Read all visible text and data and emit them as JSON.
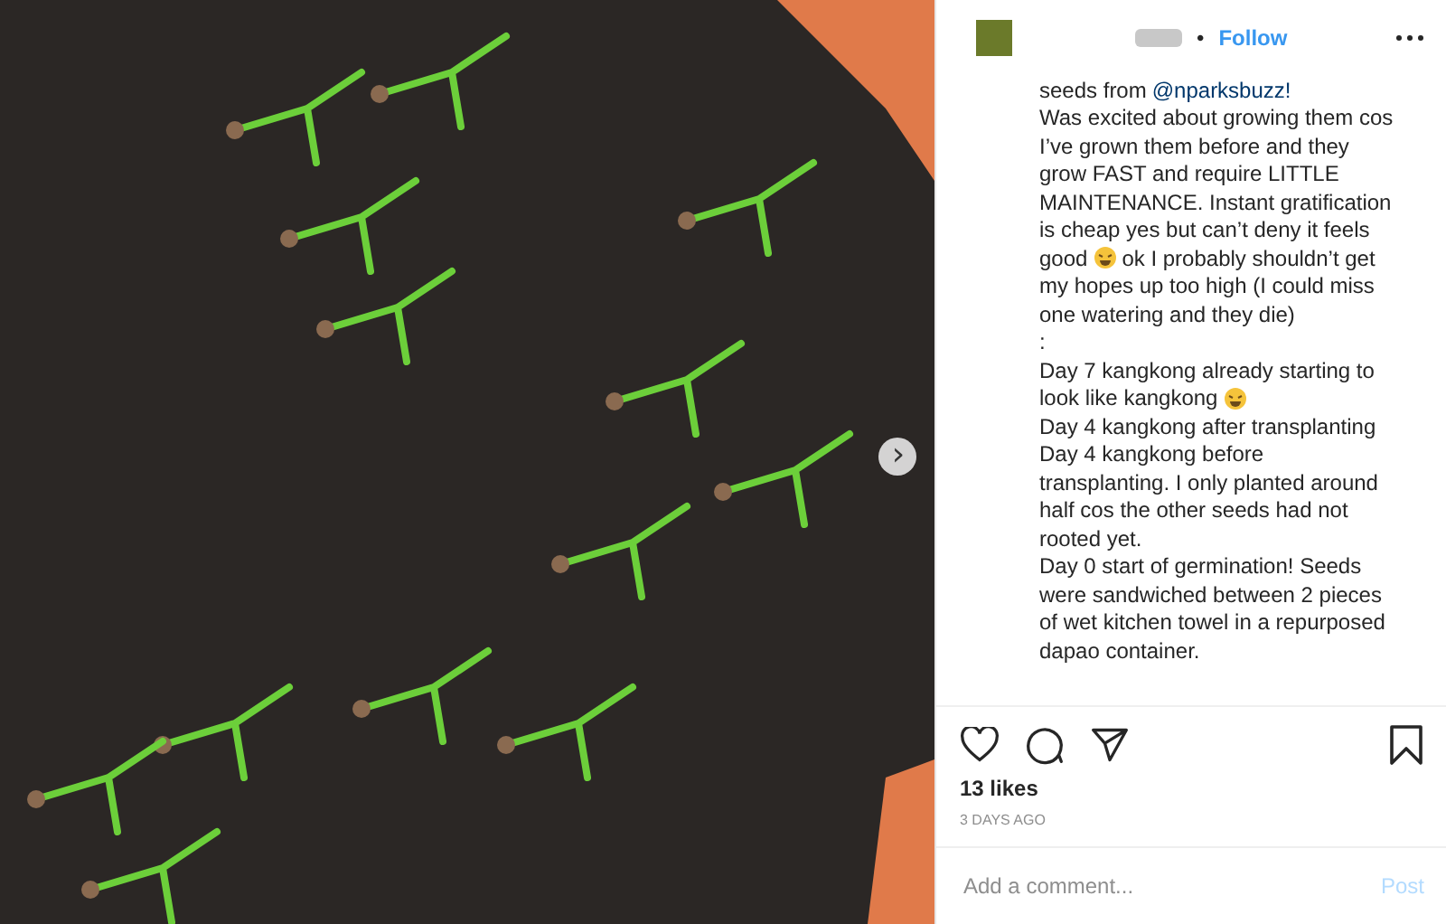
{
  "post": {
    "next_button": "›"
  },
  "header": {
    "separator": "•",
    "follow": "Follow"
  },
  "caption": [
    [
      {
        "kind": "text",
        "text": "seeds from"
      },
      {
        "kind": "link",
        "text": "@nparksbuzz!"
      }
    ],
    [
      {
        "kind": "text",
        "text": "Was excited about growing them cos"
      }
    ],
    [
      {
        "kind": "text",
        "text": "I’ve grown them before and they"
      }
    ],
    [
      {
        "kind": "text",
        "text": "grow FAST and require LITTLE"
      }
    ],
    [
      {
        "kind": "text",
        "text": "MAINTENANCE. Instant gratification"
      }
    ],
    [
      {
        "kind": "text",
        "text": "is cheap yes but can’t deny it feels"
      }
    ],
    [
      {
        "kind": "text",
        "text": "good"
      },
      {
        "kind": "emoji"
      },
      {
        "kind": "text",
        "text": "ok I probably shouldn’t get"
      }
    ],
    [
      {
        "kind": "text",
        "text": "my hopes up too high (I could miss"
      }
    ],
    [
      {
        "kind": "text",
        "text": "one watering and they die)"
      }
    ],
    [
      {
        "kind": "text",
        "text": ":"
      }
    ],
    [
      {
        "kind": "text",
        "text": "Day 7 kangkong already starting to"
      }
    ],
    [
      {
        "kind": "text",
        "text": "look like kangkong"
      },
      {
        "kind": "emoji"
      }
    ],
    [
      {
        "kind": "text",
        "text": "Day 4 kangkong after transplanting"
      }
    ],
    [
      {
        "kind": "text",
        "text": "Day 4 kangkong before"
      }
    ],
    [
      {
        "kind": "text",
        "text": "transplanting. I only planted around"
      }
    ],
    [
      {
        "kind": "text",
        "text": "half cos the other seeds had not"
      }
    ],
    [
      {
        "kind": "text",
        "text": "rooted yet."
      }
    ],
    [
      {
        "kind": "text",
        "text": "Day 0 start of germination! Seeds"
      }
    ],
    [
      {
        "kind": "text",
        "text": "were sandwiched between 2 pieces"
      }
    ],
    [
      {
        "kind": "text",
        "text": "of wet kitchen towel in a repurposed"
      }
    ],
    [
      {
        "kind": "text",
        "text": "dapao container."
      }
    ]
  ],
  "likes": "13 likes",
  "time": "3 DAYS AGO",
  "comment": {
    "placeholder": "Add a comment...",
    "post": "Post"
  }
}
